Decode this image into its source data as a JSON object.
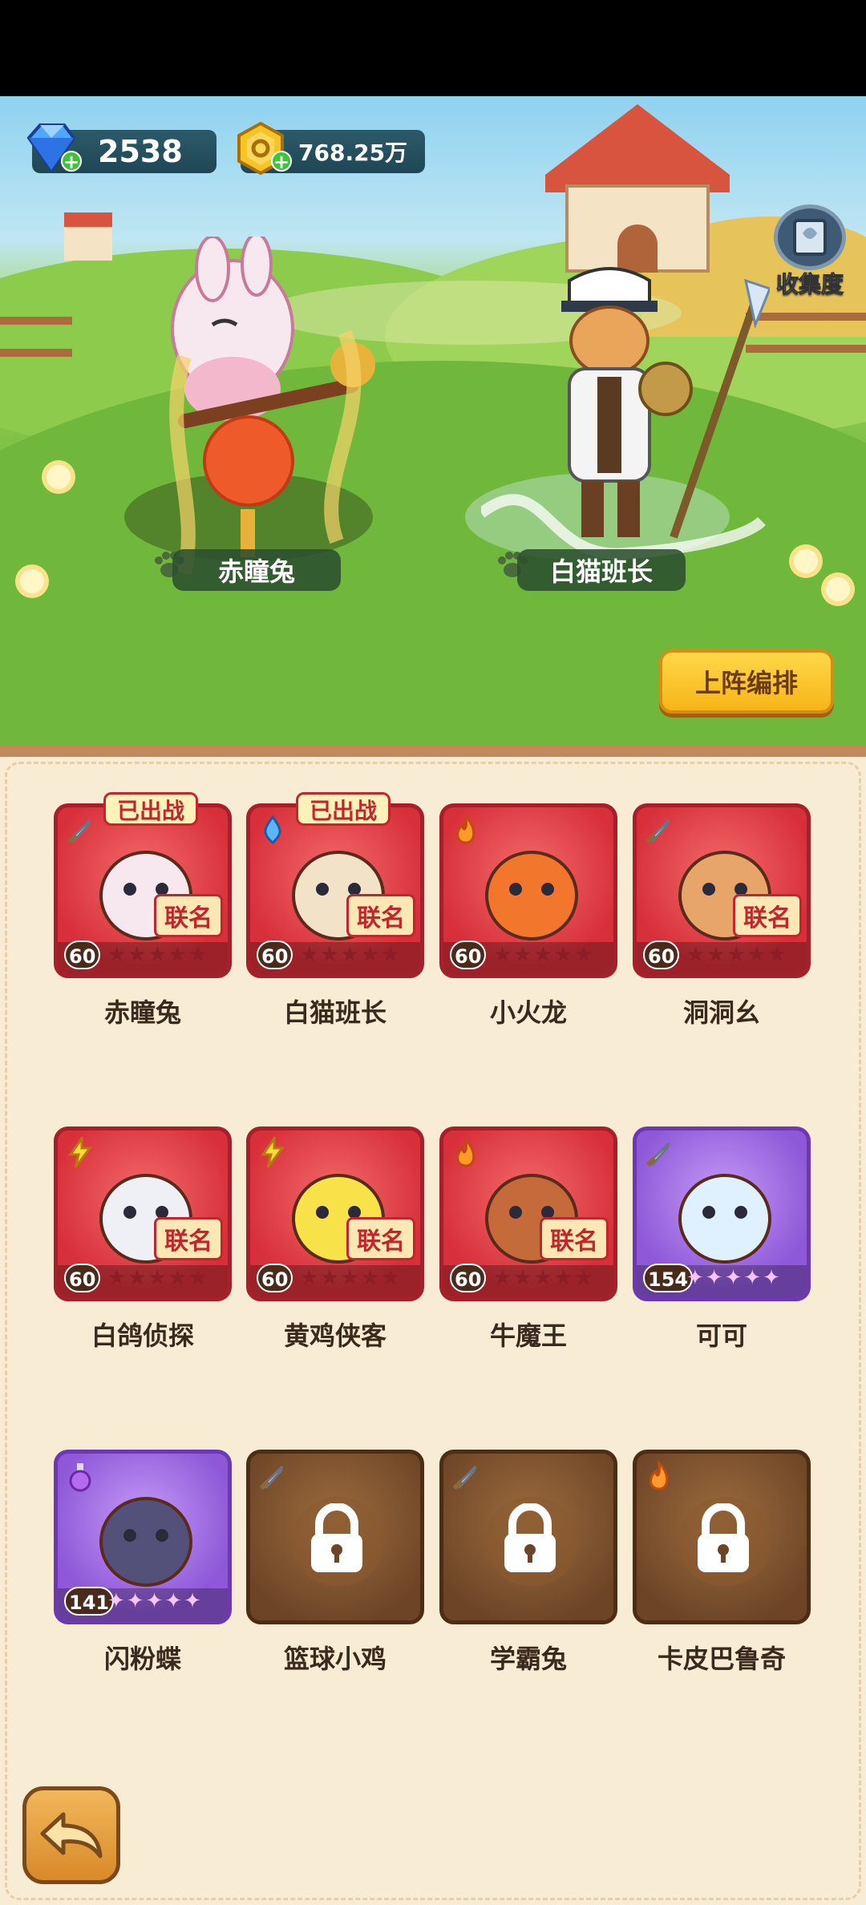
{
  "currency": {
    "gems": "2538",
    "gold": "768.25万"
  },
  "collection": {
    "label": "收集度"
  },
  "showcase": [
    {
      "name": "赤瞳兔"
    },
    {
      "name": "白猫班长"
    }
  ],
  "formation_button": "上阵编排",
  "deployed_label": "已出战",
  "roster": [
    {
      "name": "赤瞳兔",
      "level": "60",
      "badge": "联名",
      "rarity": "red",
      "element": "sword",
      "deployed": true,
      "locked": false,
      "hero_color": "#f7e8ef"
    },
    {
      "name": "白猫班长",
      "level": "60",
      "badge": "联名",
      "rarity": "red",
      "element": "water",
      "deployed": true,
      "locked": false,
      "hero_color": "#f2e2c8"
    },
    {
      "name": "小火龙",
      "level": "60",
      "badge": "",
      "rarity": "red",
      "element": "fire",
      "deployed": false,
      "locked": false,
      "hero_color": "#f2762c"
    },
    {
      "name": "洞洞幺",
      "level": "60",
      "badge": "联名",
      "rarity": "red",
      "element": "sword",
      "deployed": false,
      "locked": false,
      "hero_color": "#e7a56a"
    },
    {
      "name": "白鸽侦探",
      "level": "60",
      "badge": "联名",
      "rarity": "red",
      "element": "thunder",
      "deployed": false,
      "locked": false,
      "hero_color": "#eef0f5"
    },
    {
      "name": "黄鸡侠客",
      "level": "60",
      "badge": "联名",
      "rarity": "red",
      "element": "thunder",
      "deployed": false,
      "locked": false,
      "hero_color": "#f7e24a"
    },
    {
      "name": "牛魔王",
      "level": "60",
      "badge": "联名",
      "rarity": "red",
      "element": "fire",
      "deployed": false,
      "locked": false,
      "hero_color": "#c56a3a"
    },
    {
      "name": "可可",
      "level": "154",
      "badge": "",
      "rarity": "purple",
      "element": "sword",
      "deployed": false,
      "locked": false,
      "hero_color": "#dff0ff"
    },
    {
      "name": "闪粉蝶",
      "level": "141",
      "badge": "",
      "rarity": "purple",
      "element": "poison",
      "deployed": false,
      "locked": false,
      "hero_color": "#53507a"
    },
    {
      "name": "篮球小鸡",
      "level": "",
      "badge": "",
      "rarity": "locked",
      "element": "sword",
      "deployed": false,
      "locked": true,
      "hero_color": ""
    },
    {
      "name": "学霸兔",
      "level": "",
      "badge": "",
      "rarity": "locked",
      "element": "sword",
      "deployed": false,
      "locked": true,
      "hero_color": ""
    },
    {
      "name": "卡皮巴鲁奇",
      "level": "",
      "badge": "",
      "rarity": "locked",
      "element": "fire",
      "deployed": false,
      "locked": true,
      "hero_color": ""
    }
  ]
}
